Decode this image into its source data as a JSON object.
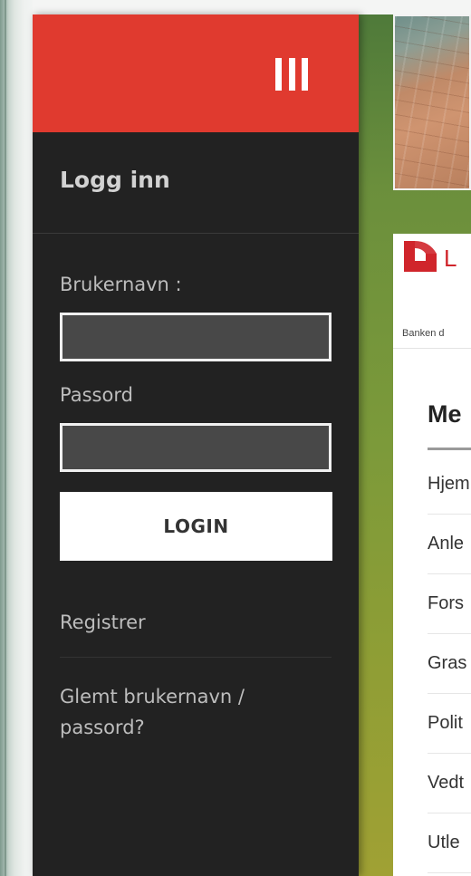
{
  "drawer": {
    "title": "Logg inn",
    "username_label": "Brukernavn :",
    "username_value": "",
    "password_label": "Passord",
    "password_value": "",
    "login_label": "LOGIN",
    "register_label": "Registrer",
    "forgot_label_line1": "Glemt brukernavn /",
    "forgot_label_line2": "passord?",
    "header_color": "#e03a2f",
    "background_color": "#222222"
  },
  "content": {
    "logo_text": "L",
    "tagline": "Banken d",
    "menu_title": "Me",
    "menu_items": [
      "Hjem",
      "Anle",
      "Fors",
      "Gras",
      "Polit",
      "Vedt",
      "Utle"
    ],
    "brand_color": "#d0252b"
  }
}
